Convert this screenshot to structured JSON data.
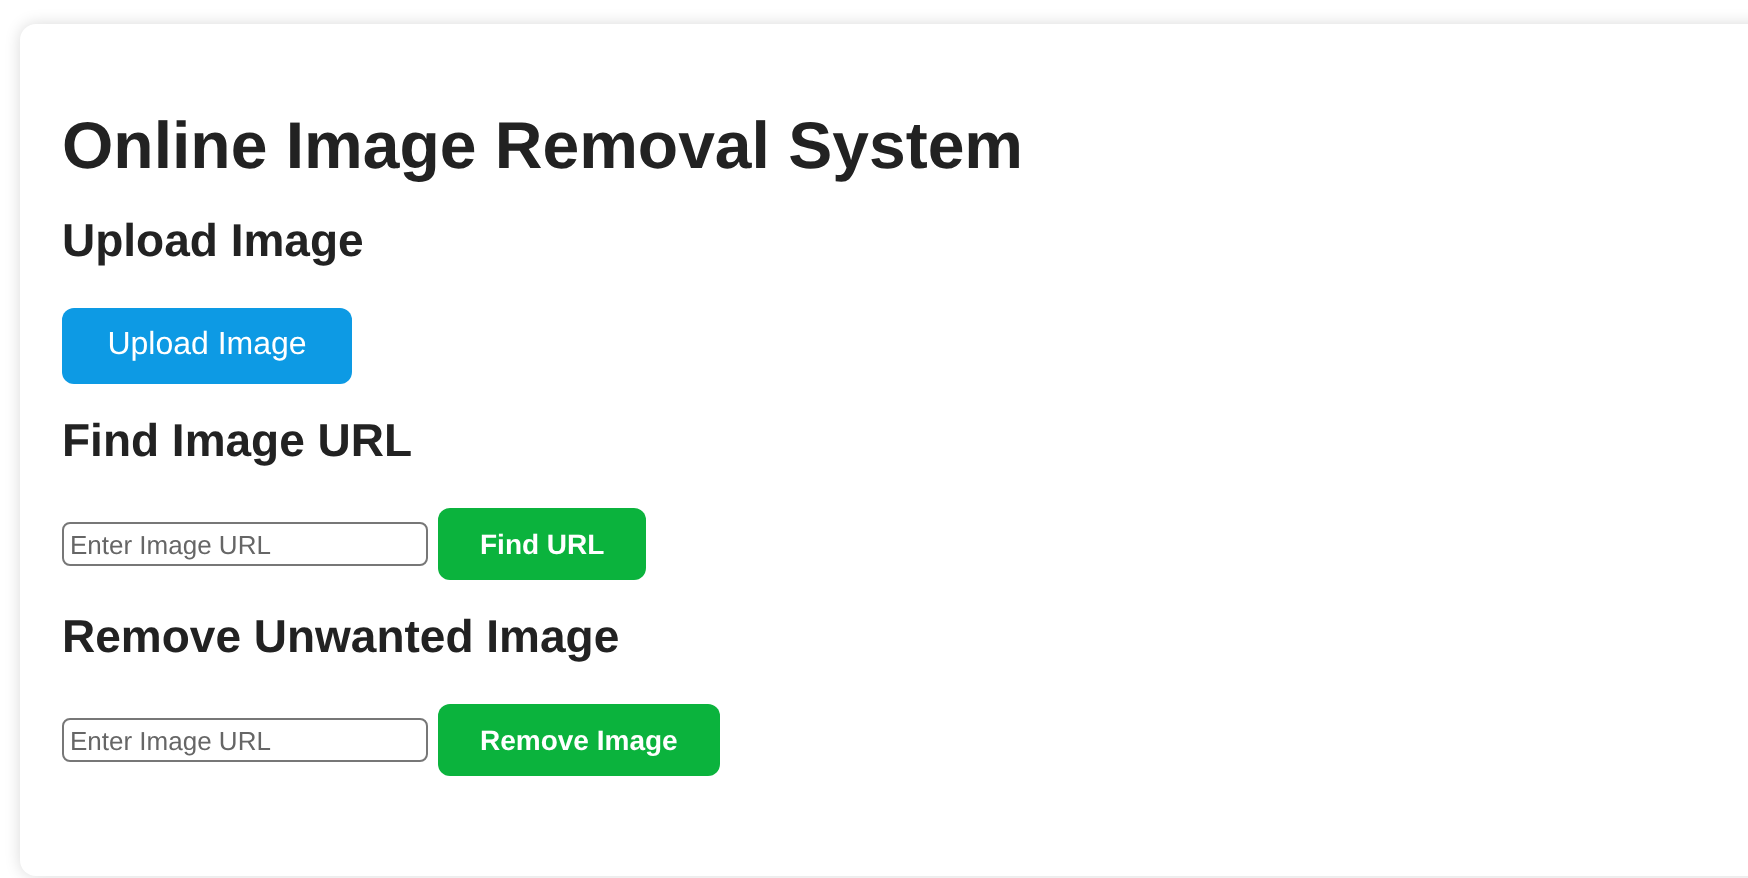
{
  "title": "Online Image Removal System",
  "sections": [
    {
      "kind": "upload",
      "heading": "Upload Image",
      "button": "Upload Image"
    },
    {
      "kind": "form",
      "heading": "Find Image URL",
      "placeholder": "Enter Image URL",
      "button": "Find URL"
    },
    {
      "kind": "form",
      "heading": "Remove Unwanted Image",
      "placeholder": "Enter Image URL",
      "button": "Remove Image"
    }
  ]
}
